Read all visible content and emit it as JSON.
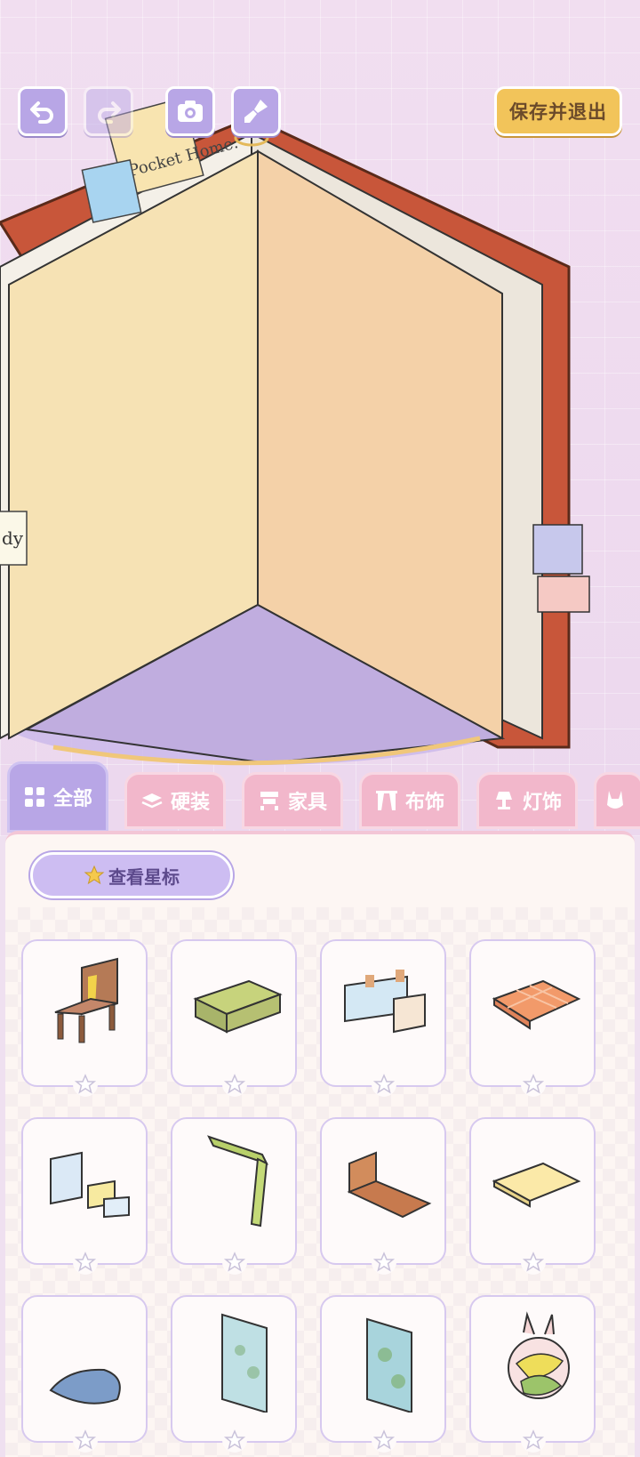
{
  "toolbar": {
    "undo_icon": "undo-icon",
    "redo_icon": "redo-icon",
    "camera_icon": "camera-icon",
    "brush_icon": "brush-icon",
    "save_label": "保存并退出"
  },
  "scene": {
    "note_text": "Pocket Home.",
    "side_note_text": "dy"
  },
  "tabs": [
    {
      "label": "全部",
      "icon": "grid-icon",
      "active": true
    },
    {
      "label": "硬装",
      "icon": "stack-icon",
      "active": false
    },
    {
      "label": "家具",
      "icon": "cabinet-icon",
      "active": false
    },
    {
      "label": "布饰",
      "icon": "curtain-icon",
      "active": false
    },
    {
      "label": "灯饰",
      "icon": "lamp-icon",
      "active": false
    },
    {
      "label": "",
      "icon": "bunny-icon",
      "active": false
    }
  ],
  "filter": {
    "star_view_label": "查看星标"
  },
  "items": [
    {
      "name": "chair",
      "favorited": false
    },
    {
      "name": "desk",
      "favorited": false
    },
    {
      "name": "wall-notes",
      "favorited": false
    },
    {
      "name": "quilt",
      "favorited": false
    },
    {
      "name": "paper-notes",
      "favorited": false
    },
    {
      "name": "curtain",
      "favorited": false
    },
    {
      "name": "bed-frame",
      "favorited": false
    },
    {
      "name": "rug",
      "favorited": false
    },
    {
      "name": "pillow",
      "favorited": false
    },
    {
      "name": "window",
      "favorited": false
    },
    {
      "name": "window-2",
      "favorited": false
    },
    {
      "name": "bunny-plush",
      "favorited": false
    }
  ],
  "colors": {
    "accent_purple": "#b8a6e6",
    "tab_pink": "#f2b7cb",
    "save_yellow": "#f2c45a"
  }
}
